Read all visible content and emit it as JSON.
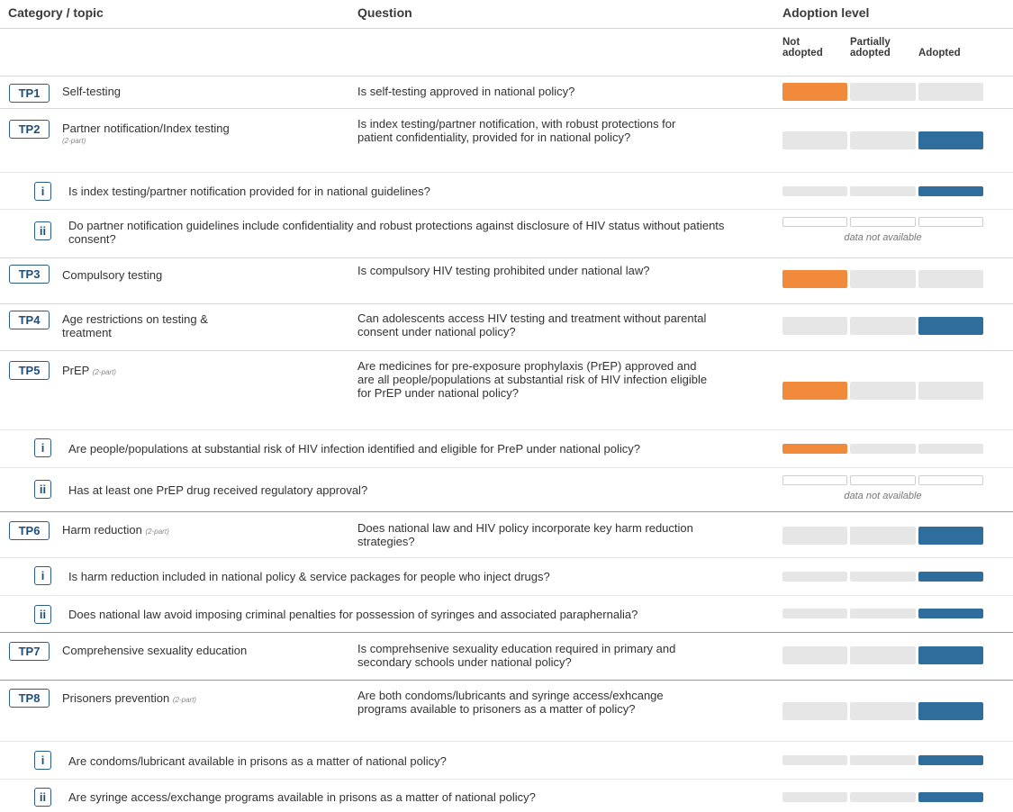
{
  "header": {
    "col_category": "Category / topic",
    "col_question": "Question",
    "col_adoption": "Adoption level"
  },
  "levels": {
    "not_adopted": "Not\nadopted",
    "partially_adopted": "Partially\nadopted",
    "adopted": "Adopted"
  },
  "colors": {
    "not_adopted": "#f28a3b",
    "adopted": "#2f6d9c",
    "neutral": "#e6e6e6",
    "tag_border": "#2b5c8a"
  },
  "na_text": "data not available",
  "rows": [
    {
      "type": "main",
      "tag": "TP1",
      "topic": "Self-testing",
      "question": "Is self-testing approved in national policy?",
      "level": "not_adopted"
    },
    {
      "type": "main",
      "tag": "TP2",
      "topic": "Partner notification/Index testing",
      "part": "(2-part)",
      "question": "Is index testing/partner notification, with robust protections for patient confidentiality, provided for in national policy?",
      "level": "adopted"
    },
    {
      "type": "sub",
      "num": "i",
      "question": "Is index testing/partner notification provided for in national guidelines?",
      "level": "adopted"
    },
    {
      "type": "sub",
      "num": "ii",
      "question": "Do partner notification guidelines include confidentiality and robust protections against disclosure of HIV status without patients consent?",
      "level": "na"
    },
    {
      "type": "main",
      "tag": "TP3",
      "topic": "Compulsory testing",
      "question": "Is compulsory HIV testing prohibited under national law?",
      "level": "not_adopted"
    },
    {
      "type": "main",
      "tag": "TP4",
      "topic": "Age restrictions on testing & treatment",
      "question": "Can adolescents access HIV testing and treatment without parental consent under national policy?",
      "level": "adopted"
    },
    {
      "type": "main",
      "tag": "TP5",
      "topic": "PrEP",
      "part": "(2-part)",
      "question": "Are medicines for pre-exposure prophylaxis (PrEP) approved and are all people/populations at substantial risk of HIV infection eligible for PrEP under national policy?",
      "level": "not_adopted"
    },
    {
      "type": "sub",
      "num": "i",
      "question": "Are people/populations at substantial risk of HIV infection identified and eligible for PreP under national policy?",
      "level": "not_adopted"
    },
    {
      "type": "sub",
      "num": "ii",
      "question": "Has at least one PrEP drug received regulatory approval?",
      "level": "na"
    },
    {
      "type": "main",
      "tag": "TP6",
      "topic": "Harm reduction",
      "part": "(2-part)",
      "question": "Does national law and HIV policy incorporate key harm reduction strategies?",
      "level": "adopted"
    },
    {
      "type": "sub",
      "num": "i",
      "question": "Is harm reduction included in national policy & service packages for people who inject drugs?",
      "level": "adopted"
    },
    {
      "type": "sub",
      "num": "ii",
      "question": "Does national law avoid imposing criminal penalties for possession of syringes and associated paraphernalia?",
      "level": "adopted"
    },
    {
      "type": "main",
      "tag": "TP7",
      "topic": "Comprehensive sexuality education",
      "question": "Is comprehsenive sexuality education required in primary and secondary schools under national policy?",
      "level": "adopted"
    },
    {
      "type": "main",
      "tag": "TP8",
      "topic": "Prisoners prevention",
      "part": "(2-part)",
      "question": "Are both condoms/lubricants and syringe access/exhcange programs available to prisoners as a matter of policy?",
      "level": "adopted"
    },
    {
      "type": "sub",
      "num": "i",
      "question": "Are condoms/lubricant available in prisons as a matter of national policy?",
      "level": "adopted"
    },
    {
      "type": "sub",
      "num": "ii",
      "question": "Are syringe access/exchange programs available in prisons as a matter of national policy?",
      "level": "adopted"
    }
  ]
}
